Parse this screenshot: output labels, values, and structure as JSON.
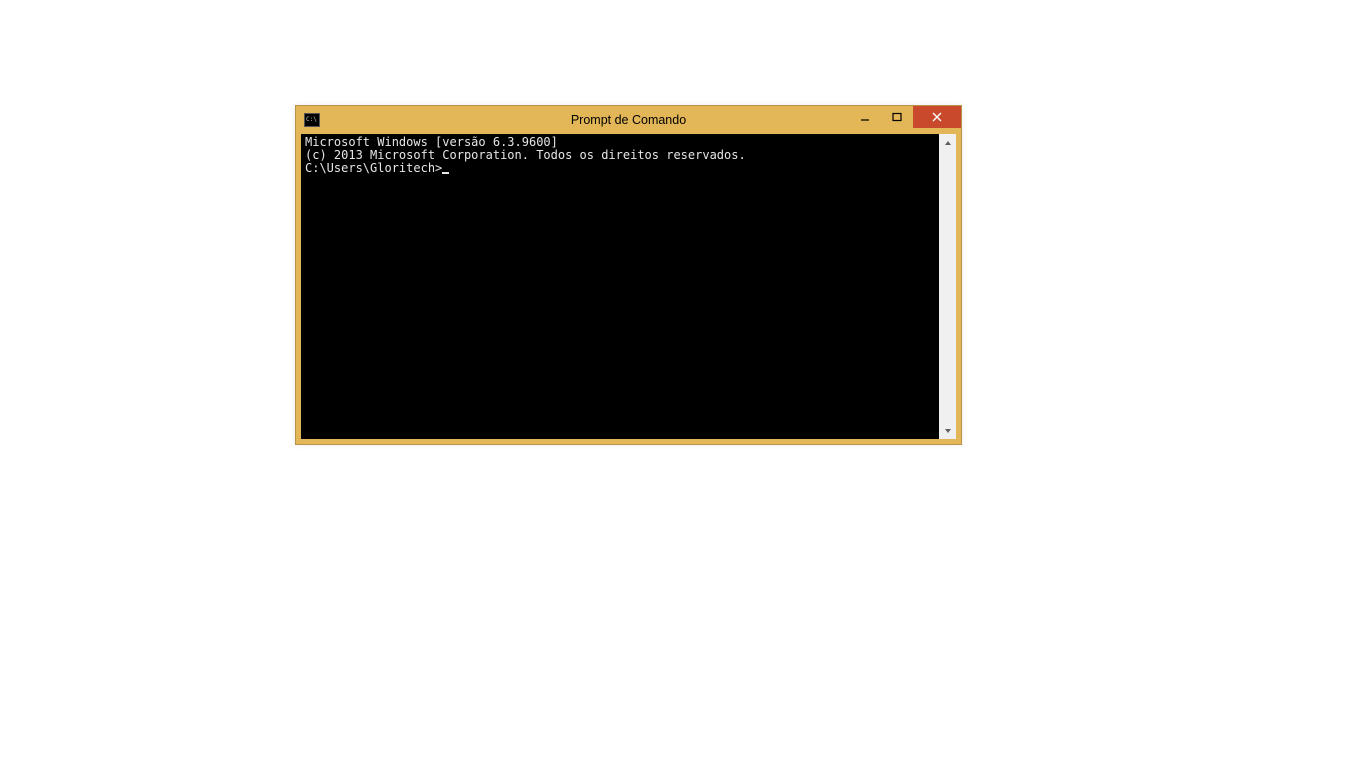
{
  "window": {
    "title": "Prompt de Comando"
  },
  "console": {
    "line1": "Microsoft Windows [versão 6.3.9600]",
    "line2": "(c) 2013 Microsoft Corporation. Todos os direitos reservados.",
    "blank": "",
    "prompt": "C:\\Users\\Gloritech>"
  }
}
